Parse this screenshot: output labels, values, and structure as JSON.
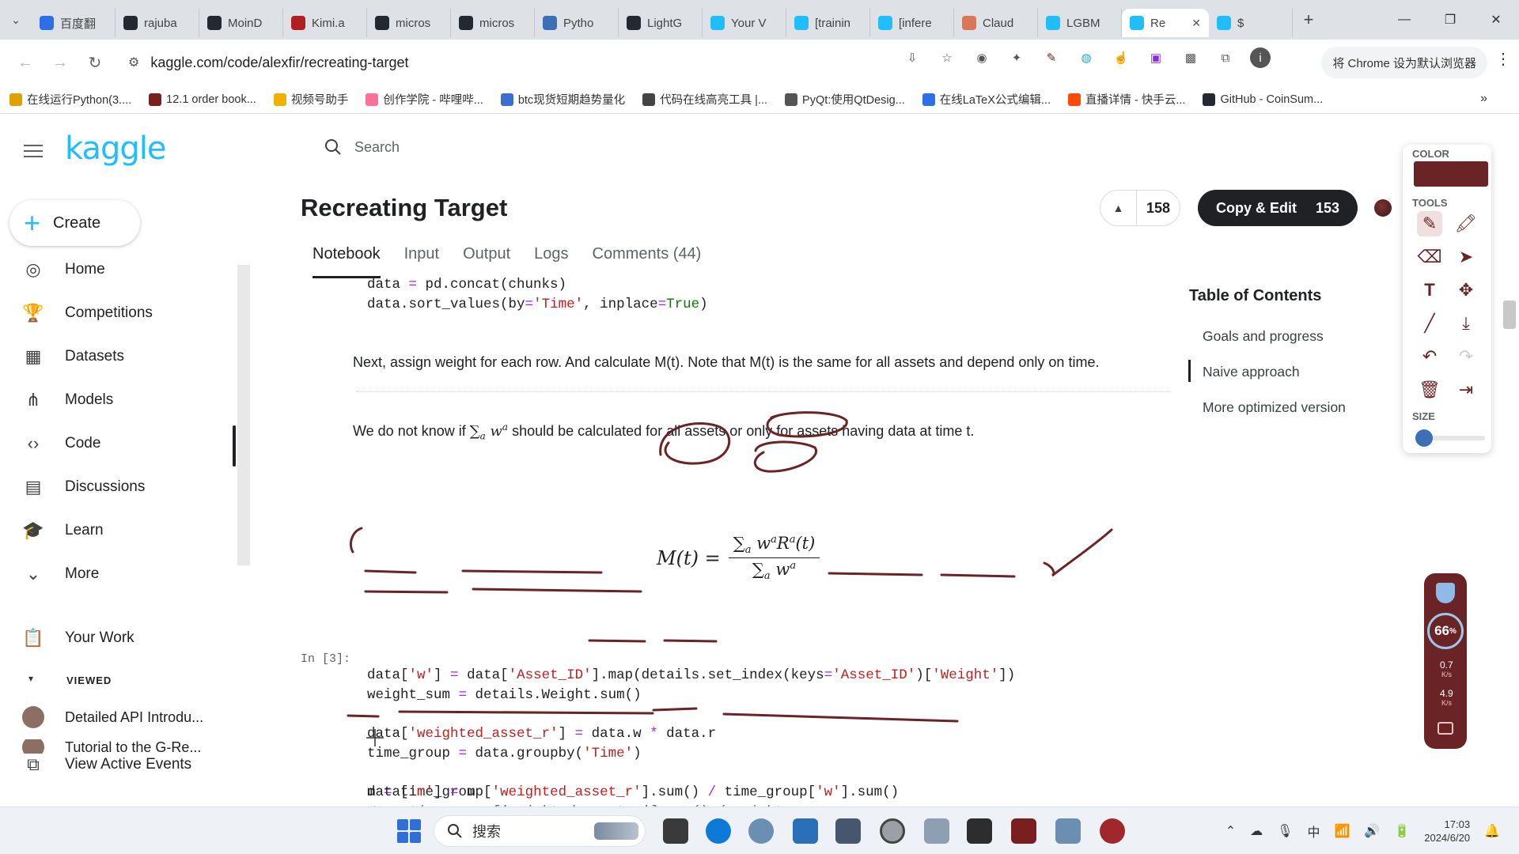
{
  "browser": {
    "tabs": [
      {
        "label": "百度翻",
        "icon": "baidu-fanyi-icon",
        "color": "#2d6fe6"
      },
      {
        "label": "rajuba",
        "icon": "github-icon",
        "color": "#24292f"
      },
      {
        "label": "MoinD",
        "icon": "github-icon",
        "color": "#24292f"
      },
      {
        "label": "Kimi.a",
        "icon": "kimi-icon",
        "color": "#b02020"
      },
      {
        "label": "micros",
        "icon": "github-icon",
        "color": "#24292f"
      },
      {
        "label": "micros",
        "icon": "github-icon",
        "color": "#24292f"
      },
      {
        "label": "Pytho",
        "icon": "python-docs-icon",
        "color": "#3b6fb6"
      },
      {
        "label": "LightG",
        "icon": "github-icon",
        "color": "#24292f"
      },
      {
        "label": "Your V",
        "icon": "kaggle-k-icon",
        "color": "#20beff"
      },
      {
        "label": "[trainin",
        "icon": "kaggle-k-icon",
        "color": "#20beff"
      },
      {
        "label": "[infere",
        "icon": "kaggle-k-icon",
        "color": "#20beff"
      },
      {
        "label": "Claud",
        "icon": "claude-icon",
        "color": "#d97757"
      },
      {
        "label": "LGBM",
        "icon": "kaggle-k-icon",
        "color": "#20beff"
      },
      {
        "label": "Re",
        "icon": "kaggle-k-icon",
        "color": "#20beff",
        "active": true
      },
      {
        "label": "$",
        "icon": "kaggle-k-icon",
        "color": "#20beff"
      }
    ],
    "new_tab_label": "+",
    "url": "kaggle.com/code/alexfir/recreating-target",
    "default_browser_label": "将 Chrome 设为默认浏览器",
    "bookmarks": [
      {
        "label": "在线运行Python(3....",
        "color": "#e0a100"
      },
      {
        "label": "12.1 order book...",
        "color": "#7a1f1f"
      },
      {
        "label": "视频号助手",
        "color": "#f0b000"
      },
      {
        "label": "创作学院 - 哔哩哔...",
        "color": "#fb7299"
      },
      {
        "label": "btc现货短期趋势量化",
        "color": "#3a6fd0"
      },
      {
        "label": "代码在线高亮工具 |...",
        "color": "#444"
      },
      {
        "label": "PyQt:使用QtDesig...",
        "color": "#555"
      },
      {
        "label": "在线LaTeX公式编辑...",
        "color": "#2d6fe6"
      },
      {
        "label": "直播详情 - 快手云...",
        "color": "#ff4906"
      },
      {
        "label": "GitHub - CoinSum...",
        "color": "#24292f"
      }
    ]
  },
  "kaggle": {
    "search_placeholder": "Search",
    "create_label": "Create",
    "nav": [
      {
        "label": "Home",
        "icon": "compass-icon",
        "glyph": "◎"
      },
      {
        "label": "Competitions",
        "icon": "trophy-icon",
        "glyph": "🏆"
      },
      {
        "label": "Datasets",
        "icon": "table-icon",
        "glyph": "▦"
      },
      {
        "label": "Models",
        "icon": "models-icon",
        "glyph": "⋔"
      },
      {
        "label": "Code",
        "icon": "code-icon",
        "glyph": "‹›"
      },
      {
        "label": "Discussions",
        "icon": "discussions-icon",
        "glyph": "▤"
      },
      {
        "label": "Learn",
        "icon": "graduation-cap-icon",
        "glyph": "🎓"
      },
      {
        "label": "More",
        "icon": "chevron-down-icon",
        "glyph": "⌄"
      }
    ],
    "your_work_label": "Your Work",
    "viewed_label": "VIEWED",
    "viewed_items": [
      {
        "label": "Detailed API Introdu..."
      },
      {
        "label": "Tutorial to the G-Re..."
      }
    ],
    "view_active_events_label": "View Active Events",
    "notebook": {
      "title": "Recreating Target",
      "upvotes": "158",
      "copy_edit_label": "Copy & Edit",
      "copy_edit_count": "153",
      "tabs": [
        "Notebook",
        "Input",
        "Output",
        "Logs",
        "Comments (44)"
      ],
      "md_text_1": "Next, assign weight for each row. And calculate M(t). Note that M(t) is the same for all assets and depend only on time.",
      "md_text_2_a": "We do not know if ",
      "md_text_2_b": " should be calculated for all assets or only for assets having data at time t.",
      "cell_label": "In [3]:"
    },
    "toc": {
      "title": "Table of Contents",
      "items": [
        "Goals and progress",
        "Naive approach",
        "More optimized version"
      ]
    }
  },
  "draw_toolbar": {
    "color_label": "COLOR",
    "tools_label": "TOOLS",
    "size_label": "SIZE",
    "current_color": "#6a2426"
  },
  "speed_widget": {
    "percent": "66",
    "percent_unit": "%",
    "upload": "0.7",
    "download": "4.9",
    "unit": "K/s"
  },
  "taskbar": {
    "search_label": "搜索",
    "ime": "中",
    "time": "17:03",
    "date": "2024/6/20"
  }
}
